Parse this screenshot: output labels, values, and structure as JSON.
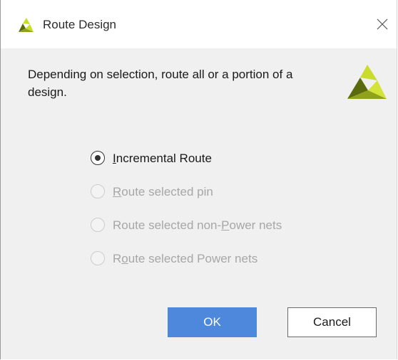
{
  "window": {
    "title": "Route Design",
    "close_icon": "close-icon",
    "app_icon": "vivado-logo-icon"
  },
  "description": "Depending on selection, route all or a portion of a design.",
  "brand_logo": "vivado-logo",
  "colors": {
    "logo_dark": "#5a6b0e",
    "logo_light": "#c9dc2c",
    "ok_button": "#4d88dc",
    "disabled_text": "#a7a7a7"
  },
  "options": [
    {
      "pre": "",
      "mnemonic": "I",
      "post": "ncremental Route",
      "selected": true,
      "enabled": true
    },
    {
      "pre": "",
      "mnemonic": "R",
      "post": "oute selected pin",
      "selected": false,
      "enabled": false
    },
    {
      "pre": "Route selected non-",
      "mnemonic": "P",
      "post": "ower nets",
      "selected": false,
      "enabled": false
    },
    {
      "pre": "R",
      "mnemonic": "o",
      "post": "ute selected Power nets",
      "selected": false,
      "enabled": false
    }
  ],
  "buttons": {
    "ok": "OK",
    "cancel": "Cancel"
  }
}
